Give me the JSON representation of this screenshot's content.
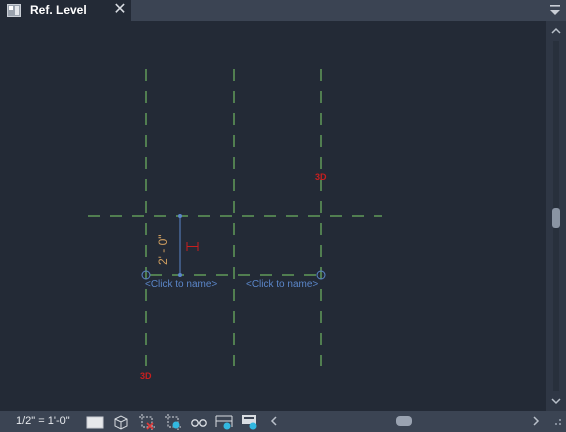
{
  "tab": {
    "title": "Ref. Level",
    "close_glyph": "✕",
    "icon": "view-plan-icon"
  },
  "canvas": {
    "grid_labels": [
      "<Click to name>",
      "<Click to name>"
    ],
    "tags_3d": [
      "3D",
      "3D"
    ],
    "dimension": "2' - 0\""
  },
  "status": {
    "scale": "1/2\" = 1'-0\"",
    "icons": [
      "detail-level-icon",
      "visual-style-icon",
      "crop-region-icon",
      "crop-toggle-icon",
      "temporary-hide-icon",
      "reveal-hidden-icon",
      "analytical-model-icon",
      "worksharing-icon"
    ]
  },
  "colors": {
    "background": "#232a36",
    "grid_line": "#7fd36b",
    "label_blue": "#5b86c9",
    "tag_red": "#c81f1f",
    "dimension": "#d2a060",
    "chrome": "#3b4453"
  }
}
